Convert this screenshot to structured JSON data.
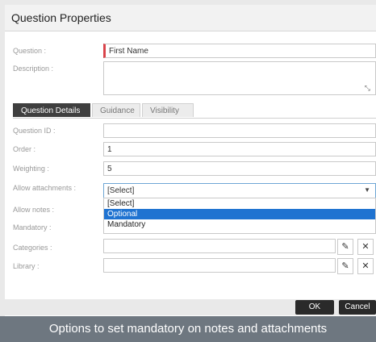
{
  "dialog": {
    "title": "Question Properties"
  },
  "fields": {
    "question": {
      "label": "Question :",
      "value": "First Name"
    },
    "description": {
      "label": "Description :",
      "value": ""
    }
  },
  "tabs": [
    {
      "label": "Question Details",
      "active": true
    },
    {
      "label": "Guidance",
      "active": false
    },
    {
      "label": "Visibility",
      "active": false
    }
  ],
  "details": {
    "question_id": {
      "label": "Question ID :",
      "value": ""
    },
    "order": {
      "label": "Order :",
      "value": "1"
    },
    "weighting": {
      "label": "Weighting :",
      "value": "5"
    },
    "allow_attachments": {
      "label": "Allow attachments :",
      "value": "[Select]"
    },
    "allow_notes": {
      "label": "Allow notes :"
    },
    "mandatory": {
      "label": "Mandatory :"
    },
    "categories": {
      "label": "Categories :",
      "value": ""
    },
    "library": {
      "label": "Library :",
      "value": ""
    }
  },
  "dropdown": {
    "options": [
      "[Select]",
      "Optional",
      "Mandatory"
    ],
    "selected_index": 1
  },
  "buttons": {
    "ok": "OK",
    "cancel": "Cancel"
  },
  "caption": "Options to set mandatory on notes and attachments",
  "icons": {
    "resize": "resize-icon",
    "edit": "pencil-icon",
    "clear": "close-icon",
    "chevron": "chevron-down-icon"
  },
  "colors": {
    "active_tab": "#3f3f3f",
    "selected_option": "#1f73d1",
    "required_marker": "#d9434a",
    "caption_bg": "#6e7780"
  }
}
